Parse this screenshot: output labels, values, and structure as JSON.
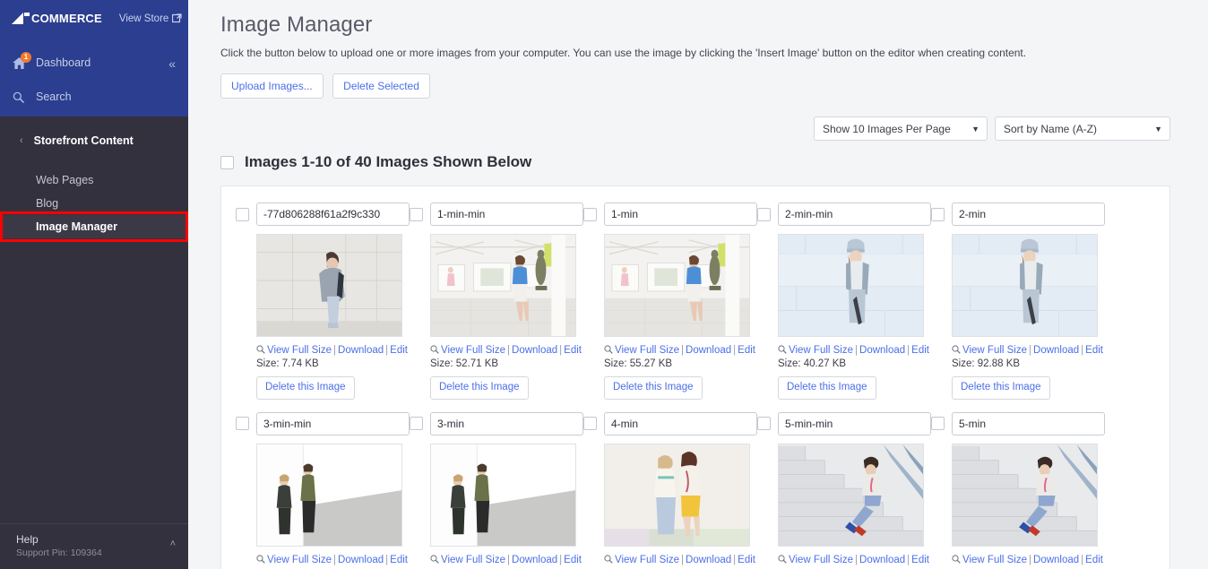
{
  "sidebar": {
    "logo_text": "COMMERCE",
    "logo_mark": "big-logo-mark",
    "view_store": "View Store",
    "dashboard": {
      "label": "Dashboard",
      "badge": "1",
      "icon": "home-icon"
    },
    "search": {
      "label": "Search",
      "icon": "search-icon"
    },
    "collapse_icon": "«",
    "section": {
      "title": "Storefront Content",
      "chevron": "‹"
    },
    "sub_items": [
      {
        "label": "Web Pages",
        "active": false,
        "highlight": false
      },
      {
        "label": "Blog",
        "active": false,
        "highlight": false
      },
      {
        "label": "Image Manager",
        "active": true,
        "highlight": true
      }
    ],
    "help": {
      "title": "Help",
      "pin": "Support Pin: 109364",
      "chevron": "˄"
    }
  },
  "header": {
    "title": "Image Manager",
    "description": "Click the button below to upload one or more images from your computer. You can use the image by clicking the 'Insert Image' button on the editor when creating content.",
    "upload_button": "Upload Images...",
    "delete_selected_button": "Delete Selected"
  },
  "controls": {
    "per_page": {
      "value": "Show 10 Images Per Page",
      "caret": "▼"
    },
    "sort_by": {
      "value": "Sort by Name (A-Z)",
      "caret": "▼"
    }
  },
  "list_header": {
    "title": "Images 1-10 of 40 Images Shown Below"
  },
  "card_labels": {
    "view_full_size": "View Full Size",
    "download": "Download",
    "edit": "Edit",
    "separator": "|",
    "delete_image": "Delete this Image",
    "size_prefix": "Size: ",
    "magnifier_icon": "magnifier-icon"
  },
  "rows": [
    {
      "cards": [
        {
          "name": "-77d806288f61a2f9c330",
          "size": "Size: 7.74 KB",
          "art": "woman-grey-coat-wall"
        },
        {
          "name": "1-min-min",
          "size": "Size: 52.71 KB",
          "art": "gallery-blue-top"
        },
        {
          "name": "1-min",
          "size": "Size: 55.27 KB",
          "art": "gallery-blue-top"
        },
        {
          "name": "2-min-min",
          "size": "Size: 40.27 KB",
          "art": "woman-beanie-wall"
        },
        {
          "name": "2-min",
          "size": "Size: 92.88 KB",
          "art": "woman-beanie-wall"
        }
      ]
    },
    {
      "cards": [
        {
          "name": "3-min-min",
          "size": "",
          "art": "two-people-corner"
        },
        {
          "name": "3-min",
          "size": "",
          "art": "two-people-corner"
        },
        {
          "name": "4-min",
          "size": "",
          "art": "two-women-denim"
        },
        {
          "name": "5-min-min",
          "size": "",
          "art": "man-on-steps"
        },
        {
          "name": "5-min",
          "size": "",
          "art": "man-on-steps"
        }
      ]
    }
  ],
  "colors": {
    "brand_blue": "#2c3e8f",
    "sidebar_dark": "#34313f",
    "link_blue": "#4b6fe8",
    "highlight_red": "#ff0000",
    "badge_orange": "#f4792a"
  }
}
